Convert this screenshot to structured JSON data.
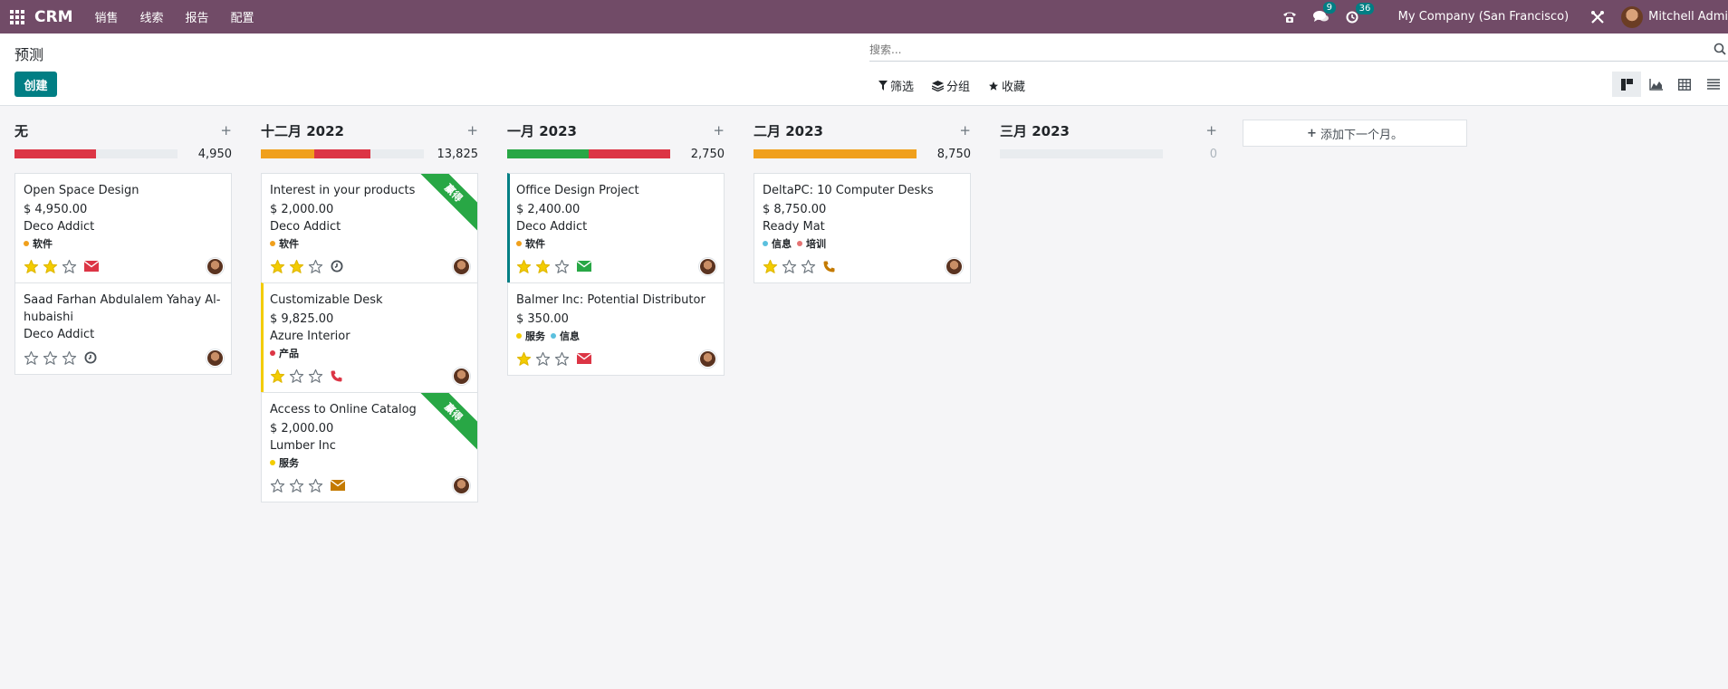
{
  "navbar": {
    "brand": "CRM",
    "menu": [
      "销售",
      "线索",
      "报告",
      "配置"
    ],
    "messages_count": "9",
    "activities_count": "36",
    "company": "My Company (San Francisco)",
    "user": "Mitchell Admi"
  },
  "control": {
    "title": "预测",
    "create_label": "创建",
    "search_placeholder": "搜索...",
    "filter_label": "筛选",
    "group_label": "分组",
    "favorites_label": "收藏",
    "views": [
      "kanban",
      "graph",
      "pivot",
      "list"
    ],
    "active_view": "kanban"
  },
  "colors": {
    "navbar": "#714b67",
    "primary": "#017e84",
    "red": "#dc3545",
    "green": "#28a745",
    "orange": "#f0a01c",
    "grey": "#e9ecef"
  },
  "columns": [
    {
      "title": "无",
      "sum": "4,950",
      "progress": [
        {
          "color": "#dc3545",
          "fraction": 0.5
        }
      ],
      "cards": [
        {
          "name": "Open Space Design",
          "revenue": "$ 4,950.00",
          "partner": "Deco Addict",
          "tags": [
            {
              "label": "软件",
              "color": "#f0a01c"
            }
          ],
          "stars": 2,
          "activity": "email-red",
          "bar": "",
          "ribbon": ""
        },
        {
          "name": "Saad Farhan Abdulalem Yahay Al-hubaishi",
          "revenue": "",
          "partner": "Deco Addict",
          "tags": [],
          "stars": 0,
          "activity": "clock",
          "bar": "",
          "ribbon": ""
        }
      ]
    },
    {
      "title": "十二月 2022",
      "sum": "13,825",
      "progress": [
        {
          "color": "#f0a01c",
          "fraction": 0.33
        },
        {
          "color": "#dc3545",
          "fraction": 0.34
        }
      ],
      "cards": [
        {
          "name": "Interest in your products",
          "revenue": "$ 2,000.00",
          "partner": "Deco Addict",
          "tags": [
            {
              "label": "软件",
              "color": "#f0a01c"
            }
          ],
          "stars": 2,
          "activity": "clock",
          "bar": "",
          "ribbon": "赢得"
        },
        {
          "name": "Customizable Desk",
          "revenue": "$ 9,825.00",
          "partner": "Azure Interior",
          "tags": [
            {
              "label": "产品",
              "color": "#dc3545"
            }
          ],
          "stars": 1,
          "activity": "phone-red",
          "bar": "yellow",
          "ribbon": ""
        },
        {
          "name": "Access to Online Catalog",
          "revenue": "$ 2,000.00",
          "partner": "Lumber Inc",
          "tags": [
            {
              "label": "服务",
              "color": "#f3cc00"
            }
          ],
          "stars": 0,
          "activity": "email-orange",
          "bar": "",
          "ribbon": "赢得"
        }
      ]
    },
    {
      "title": "一月 2023",
      "sum": "2,750",
      "progress": [
        {
          "color": "#28a745",
          "fraction": 0.5
        },
        {
          "color": "#dc3545",
          "fraction": 0.5
        }
      ],
      "cards": [
        {
          "name": "Office Design Project",
          "revenue": "$ 2,400.00",
          "partner": "Deco Addict",
          "tags": [
            {
              "label": "软件",
              "color": "#f0a01c"
            }
          ],
          "stars": 2,
          "activity": "email-green",
          "bar": "green",
          "ribbon": ""
        },
        {
          "name": "Balmer Inc: Potential Distributor",
          "revenue": "$ 350.00",
          "partner": "",
          "tags": [
            {
              "label": "服务",
              "color": "#f3cc00"
            },
            {
              "label": "信息",
              "color": "#5bc0de"
            }
          ],
          "stars": 1,
          "activity": "email-red",
          "bar": "",
          "ribbon": ""
        }
      ]
    },
    {
      "title": "二月 2023",
      "sum": "8,750",
      "progress": [
        {
          "color": "#f0a01c",
          "fraction": 1.0
        }
      ],
      "cards": [
        {
          "name": "DeltaPC: 10 Computer Desks",
          "revenue": "$ 8,750.00",
          "partner": "Ready Mat",
          "tags": [
            {
              "label": "信息",
              "color": "#5bc0de"
            },
            {
              "label": "培训",
              "color": "#e57373"
            }
          ],
          "stars": 1,
          "activity": "phone-orange",
          "bar": "",
          "ribbon": ""
        }
      ]
    },
    {
      "title": "三月 2023",
      "sum": "0",
      "progress": [],
      "cards": []
    }
  ],
  "add_month_label": "添加下一个月。"
}
